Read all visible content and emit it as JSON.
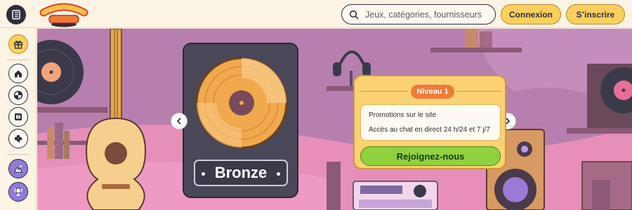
{
  "app": {
    "logo_text": "VINYL casino"
  },
  "header": {
    "search_placeholder": "Jeux, catégories, fournisseurs",
    "login_label": "Connexion",
    "signup_label": "S’inscrire"
  },
  "sidebar": {
    "items": [
      {
        "icon": "gift-icon"
      },
      {
        "icon": "home-icon"
      },
      {
        "icon": "roulette-icon"
      },
      {
        "icon": "slot-machine-icon"
      },
      {
        "icon": "clover-icon"
      },
      {
        "icon": "mountain-icon"
      },
      {
        "icon": "trophy-icon"
      }
    ]
  },
  "banner": {
    "tier_name": "Bronze",
    "level_badge": "Niveau 1",
    "benefits": [
      "Promotions sur le site",
      "Accès au chat en direct 24 h/24 et 7 j/7"
    ],
    "cta_label": "Rejoignez-nous"
  },
  "colors": {
    "accent_yellow": "#fbcf5c",
    "dark": "#2f2c3e",
    "cta_green": "#8fd13e",
    "badge_orange": "#f07a3a",
    "banner_purple": "#b77fae"
  }
}
